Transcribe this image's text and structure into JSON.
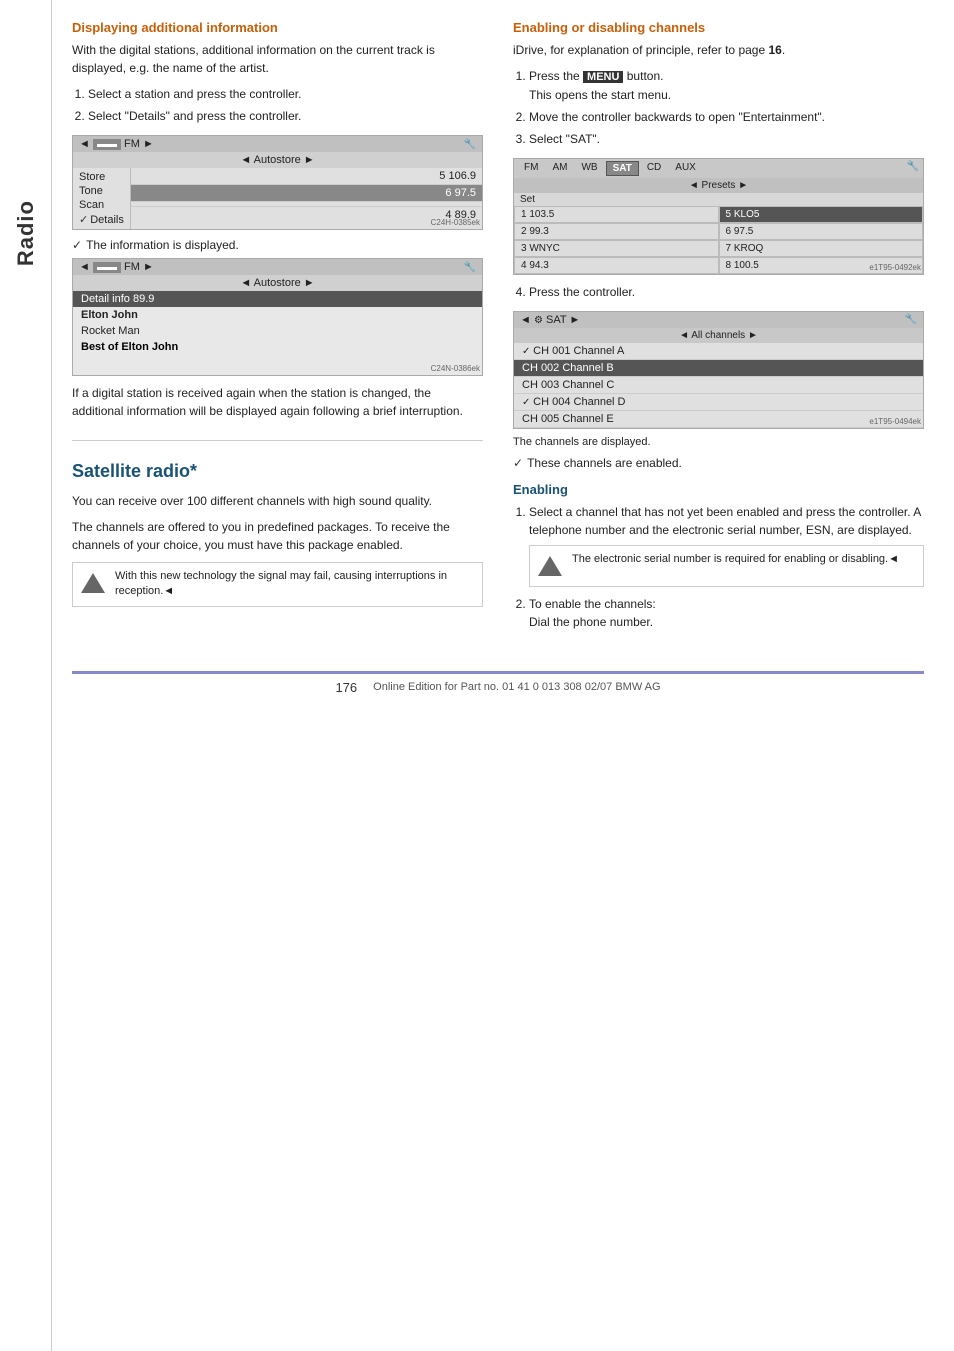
{
  "sidebar": {
    "label": "Radio"
  },
  "left_col": {
    "section1": {
      "title": "Displaying additional information",
      "body1": "With the digital stations, additional information on the current track is displayed, e.g. the name of the artist.",
      "steps": [
        "Select a station and press the controller.",
        "Select \"Details\" and press the controller."
      ],
      "screen1": {
        "top_bar": "◄ ▬▬▬ FM ►",
        "sub_bar": "◄ Autostore ►",
        "menu_items": [
          "Store",
          "Tone",
          "Scan",
          "✓Details"
        ],
        "rows": [
          {
            "left": "",
            "right": "5 106.9"
          },
          {
            "left": "",
            "right": "6 97.5"
          },
          {
            "left": "",
            "right": "4 89.9"
          }
        ],
        "icon": "🔧"
      },
      "caption1": "✓ The information is displayed.",
      "screen2": {
        "top_bar": "◄ ▬▬▬ FM ►",
        "sub_bar": "◄ Autostore ►",
        "detail_line": "Detail info 89.9",
        "lines": [
          "Elton John",
          "Rocket Man",
          "Best of Elton John"
        ]
      },
      "after_text": "If a digital station is received again when the station is changed, the additional information will be displayed again following a brief interruption."
    },
    "section2": {
      "title": "Satellite radio*",
      "body1": "You can receive over 100 different channels with high sound quality.",
      "body2": "The channels are offered to you in predefined packages. To receive the channels of your choice, you must have this package enabled.",
      "note": "With this new technology the signal may fail, causing interruptions in reception.◄"
    }
  },
  "right_col": {
    "section1": {
      "title": "Enabling or disabling channels",
      "body1": "iDrive, for explanation of principle, refer to page 16.",
      "steps": [
        {
          "text": "Press the MENU button. This opens the start menu.",
          "menu_word": "MENU"
        },
        {
          "text": "Move the controller backwards to open \"Entertainment\"."
        },
        {
          "text": "Select \"SAT\"."
        }
      ],
      "sat_screen": {
        "tabs": [
          "FM",
          "AM",
          "WB",
          "SAT",
          "CD",
          "AUX"
        ],
        "active_tab": "SAT",
        "sub_bar": "◄ Presets ►",
        "set_row": "Set",
        "grid": [
          {
            "left": "1 103.5",
            "right": "5 KLO5"
          },
          {
            "left": "2 99.3",
            "right": "6 97.5"
          },
          {
            "left": "3 WNYC",
            "right": "7 KROQ"
          },
          {
            "left": "4 94.3",
            "right": "8 100.5"
          }
        ],
        "icon": "🔧"
      },
      "step4": "Press the controller.",
      "channel_screen": {
        "top_bar_left": "◄ 🔧 SAT ►",
        "sub_bar": "◄ All channels ►",
        "channels": [
          {
            "label": "CH 001 Channel A",
            "checked": true,
            "selected": false
          },
          {
            "label": "CH 002 Channel B",
            "checked": false,
            "selected": true
          },
          {
            "label": "CH 003 Channel C",
            "checked": false,
            "selected": false
          },
          {
            "label": "CH 004 Channel D",
            "checked": true,
            "selected": false
          },
          {
            "label": "CH 005 Channel E",
            "checked": false,
            "selected": false
          }
        ],
        "icon": "🔧"
      },
      "caption_channels": "The channels are displayed.",
      "caption_enabled": "These channels are enabled."
    },
    "section2": {
      "title": "Enabling",
      "steps": [
        {
          "text": "Select a channel that has not yet been enabled and press the controller. A telephone number and the electronic serial number, ESN, are displayed.",
          "note": "The electronic serial number is required for enabling or disabling.◄"
        },
        {
          "text": "To enable the channels: Dial the phone number."
        }
      ]
    }
  },
  "footer": {
    "page_number": "176",
    "text": "Online Edition for Part no. 01 41 0 013 308 02/07 BMW AG"
  }
}
